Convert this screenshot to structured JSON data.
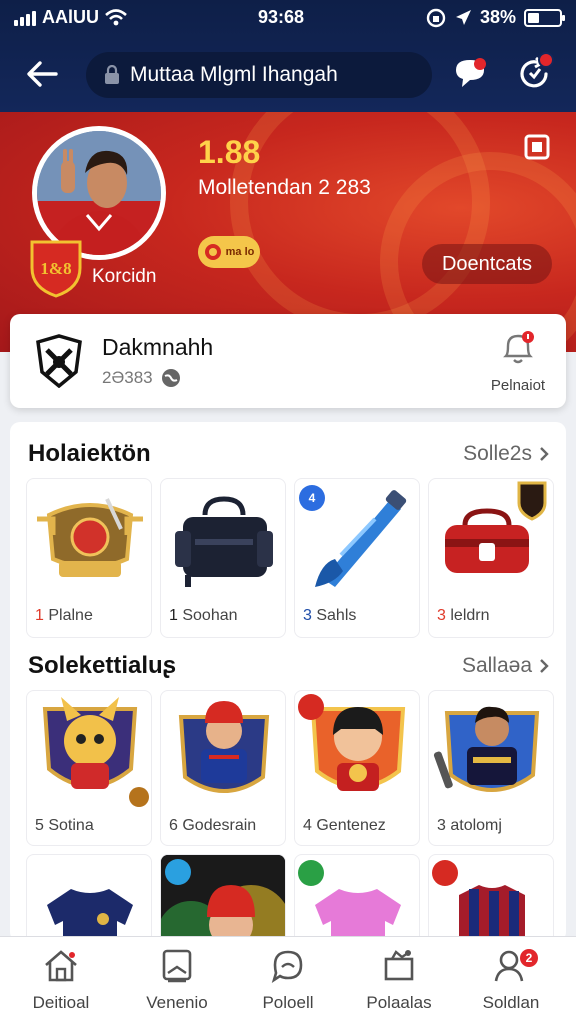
{
  "status": {
    "carrier": "AAlUU",
    "time": "93:68",
    "battery": "38%",
    "battery_level": 0.38
  },
  "header": {
    "search_text": "Muttaa Mlgml Ihangah",
    "back_icon": "arrow-left-icon",
    "chat_icon": "chat-bubble-icon",
    "refresh_icon": "refresh-icon"
  },
  "hero": {
    "number": "1.88",
    "subtitle": "Molletendan 2 283",
    "club_label": "Korcidn",
    "crest_text": "1&8",
    "chip_text": "ma lo",
    "button_label": "Doentcats",
    "colors": {
      "accent": "#ffd34a",
      "red": "#c7271e"
    }
  },
  "club_card": {
    "name": "Dakmnahh",
    "meta": "2Ə383",
    "notify_label": "Pelnaiot"
  },
  "section1": {
    "title": "Holaiektön",
    "more": "Solle2s",
    "items": [
      {
        "num": "1",
        "label": "Plalne",
        "icon": "trophy-shield-icon",
        "num_color": "#e03a2a"
      },
      {
        "num": "1",
        "label": "Soohan",
        "icon": "bag-icon",
        "num_color": "#222"
      },
      {
        "num": "3",
        "label": "Sahls",
        "icon": "rocket-icon",
        "num_color": "#1f4da8",
        "tag": "4"
      },
      {
        "num": "3",
        "label": "leldrn",
        "icon": "kit-bag-icon",
        "num_color": "#e03a2a"
      }
    ]
  },
  "section2": {
    "title": "Solekettialuʂ",
    "more": "Sallaəa",
    "items": [
      {
        "num": "5",
        "label": "Sotina",
        "icon": "mascot-cat-icon"
      },
      {
        "num": "6",
        "label": "Godesrain",
        "icon": "player-cap-icon"
      },
      {
        "num": "4",
        "label": "Gentenez",
        "icon": "mascot-helmet-icon"
      },
      {
        "num": "3",
        "label": "atolomj",
        "icon": "player-jersey-icon"
      }
    ]
  },
  "section3": {
    "items": [
      {
        "icon": "jersey-navy-icon"
      },
      {
        "icon": "mascot-red-cap-icon"
      },
      {
        "icon": "jersey-pink-icon"
      },
      {
        "icon": "jersey-striped-icon"
      }
    ]
  },
  "bottom_nav": [
    {
      "label": "Deitioal",
      "icon": "home-icon"
    },
    {
      "label": "Venenio",
      "icon": "card-icon"
    },
    {
      "label": "Poloell",
      "icon": "chat-icon"
    },
    {
      "label": "Polaalas",
      "icon": "shop-icon"
    },
    {
      "label": "Soldlan",
      "icon": "profile-icon",
      "badge": "2"
    }
  ]
}
